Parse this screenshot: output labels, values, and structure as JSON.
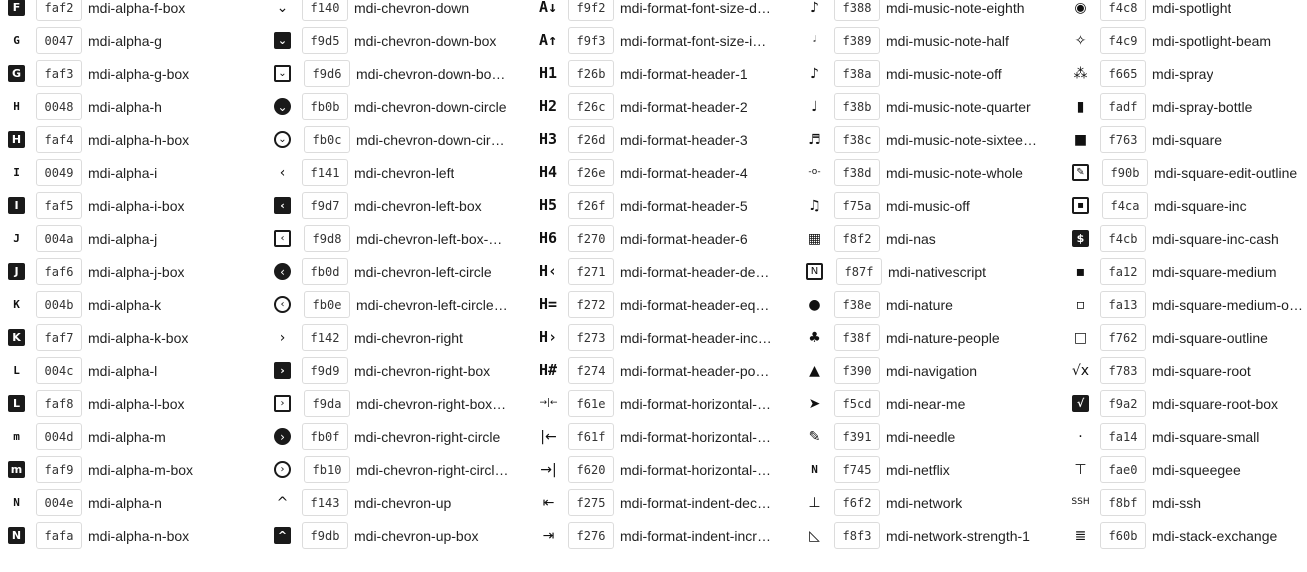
{
  "columns": [
    [
      {
        "code": "faf2",
        "name": "mdi-alpha-f-box",
        "glyph": "F",
        "style": "box",
        "icon": "alpha-f-box-icon"
      },
      {
        "code": "0047",
        "name": "mdi-alpha-g",
        "glyph": "G",
        "style": "letter",
        "icon": "alpha-g-icon"
      },
      {
        "code": "faf3",
        "name": "mdi-alpha-g-box",
        "glyph": "G",
        "style": "box",
        "icon": "alpha-g-box-icon"
      },
      {
        "code": "0048",
        "name": "mdi-alpha-h",
        "glyph": "H",
        "style": "letter",
        "icon": "alpha-h-icon"
      },
      {
        "code": "faf4",
        "name": "mdi-alpha-h-box",
        "glyph": "H",
        "style": "box",
        "icon": "alpha-h-box-icon"
      },
      {
        "code": "0049",
        "name": "mdi-alpha-i",
        "glyph": "I",
        "style": "letter",
        "icon": "alpha-i-icon"
      },
      {
        "code": "faf5",
        "name": "mdi-alpha-i-box",
        "glyph": "I",
        "style": "box",
        "icon": "alpha-i-box-icon"
      },
      {
        "code": "004a",
        "name": "mdi-alpha-j",
        "glyph": "J",
        "style": "letter",
        "icon": "alpha-j-icon"
      },
      {
        "code": "faf6",
        "name": "mdi-alpha-j-box",
        "glyph": "J",
        "style": "box",
        "icon": "alpha-j-box-icon"
      },
      {
        "code": "004b",
        "name": "mdi-alpha-k",
        "glyph": "K",
        "style": "letter",
        "icon": "alpha-k-icon"
      },
      {
        "code": "faf7",
        "name": "mdi-alpha-k-box",
        "glyph": "K",
        "style": "box",
        "icon": "alpha-k-box-icon"
      },
      {
        "code": "004c",
        "name": "mdi-alpha-l",
        "glyph": "L",
        "style": "letter",
        "icon": "alpha-l-icon"
      },
      {
        "code": "faf8",
        "name": "mdi-alpha-l-box",
        "glyph": "L",
        "style": "box",
        "icon": "alpha-l-box-icon"
      },
      {
        "code": "004d",
        "name": "mdi-alpha-m",
        "glyph": "m",
        "style": "letter",
        "icon": "alpha-m-icon"
      },
      {
        "code": "faf9",
        "name": "mdi-alpha-m-box",
        "glyph": "m",
        "style": "box",
        "icon": "alpha-m-box-icon"
      },
      {
        "code": "004e",
        "name": "mdi-alpha-n",
        "glyph": "N",
        "style": "letter",
        "icon": "alpha-n-icon"
      },
      {
        "code": "fafa",
        "name": "mdi-alpha-n-box",
        "glyph": "N",
        "style": "box",
        "icon": "alpha-n-box-icon"
      }
    ],
    [
      {
        "code": "f140",
        "name": "mdi-chevron-down",
        "glyph": "⌄",
        "style": "plain",
        "icon": "chevron-down-icon"
      },
      {
        "code": "f9d5",
        "name": "mdi-chevron-down-box",
        "glyph": "⌄",
        "style": "box",
        "icon": "chevron-down-box-icon"
      },
      {
        "code": "f9d6",
        "name": "mdi-chevron-down-box-outline",
        "glyph": "⌄",
        "style": "box-line",
        "icon": "chevron-down-box-outline-icon"
      },
      {
        "code": "fb0b",
        "name": "mdi-chevron-down-circle",
        "glyph": "⌄",
        "style": "circle-fill",
        "icon": "chevron-down-circle-icon"
      },
      {
        "code": "fb0c",
        "name": "mdi-chevron-down-circle-outline",
        "glyph": "⌄",
        "style": "circle-line",
        "icon": "chevron-down-circle-outline-icon"
      },
      {
        "code": "f141",
        "name": "mdi-chevron-left",
        "glyph": "‹",
        "style": "plain",
        "icon": "chevron-left-icon"
      },
      {
        "code": "f9d7",
        "name": "mdi-chevron-left-box",
        "glyph": "‹",
        "style": "box",
        "icon": "chevron-left-box-icon"
      },
      {
        "code": "f9d8",
        "name": "mdi-chevron-left-box-outline",
        "glyph": "‹",
        "style": "box-line",
        "icon": "chevron-left-box-outline-icon"
      },
      {
        "code": "fb0d",
        "name": "mdi-chevron-left-circle",
        "glyph": "‹",
        "style": "circle-fill",
        "icon": "chevron-left-circle-icon"
      },
      {
        "code": "fb0e",
        "name": "mdi-chevron-left-circle-outline",
        "glyph": "‹",
        "style": "circle-line",
        "icon": "chevron-left-circle-outline-icon"
      },
      {
        "code": "f142",
        "name": "mdi-chevron-right",
        "glyph": "›",
        "style": "plain",
        "icon": "chevron-right-icon"
      },
      {
        "code": "f9d9",
        "name": "mdi-chevron-right-box",
        "glyph": "›",
        "style": "box",
        "icon": "chevron-right-box-icon"
      },
      {
        "code": "f9da",
        "name": "mdi-chevron-right-box-outline",
        "glyph": "›",
        "style": "box-line",
        "icon": "chevron-right-box-outline-icon"
      },
      {
        "code": "fb0f",
        "name": "mdi-chevron-right-circle",
        "glyph": "›",
        "style": "circle-fill",
        "icon": "chevron-right-circle-icon"
      },
      {
        "code": "fb10",
        "name": "mdi-chevron-right-circle-outline",
        "glyph": "›",
        "style": "circle-line",
        "icon": "chevron-right-circle-outline-icon"
      },
      {
        "code": "f143",
        "name": "mdi-chevron-up",
        "glyph": "^",
        "style": "plain",
        "icon": "chevron-up-icon"
      },
      {
        "code": "f9db",
        "name": "mdi-chevron-up-box",
        "glyph": "^",
        "style": "box",
        "icon": "chevron-up-box-icon"
      }
    ],
    [
      {
        "code": "f9f2",
        "name": "mdi-format-font-size-decrease",
        "glyph": "A↓",
        "style": "header",
        "icon": "format-font-size-decrease-icon"
      },
      {
        "code": "f9f3",
        "name": "mdi-format-font-size-increase",
        "glyph": "A↑",
        "style": "header",
        "icon": "format-font-size-increase-icon"
      },
      {
        "code": "f26b",
        "name": "mdi-format-header-1",
        "glyph": "H1",
        "style": "header",
        "icon": "format-header-1-icon"
      },
      {
        "code": "f26c",
        "name": "mdi-format-header-2",
        "glyph": "H2",
        "style": "header",
        "icon": "format-header-2-icon"
      },
      {
        "code": "f26d",
        "name": "mdi-format-header-3",
        "glyph": "H3",
        "style": "header",
        "icon": "format-header-3-icon"
      },
      {
        "code": "f26e",
        "name": "mdi-format-header-4",
        "glyph": "H4",
        "style": "header",
        "icon": "format-header-4-icon"
      },
      {
        "code": "f26f",
        "name": "mdi-format-header-5",
        "glyph": "H5",
        "style": "header",
        "icon": "format-header-5-icon"
      },
      {
        "code": "f270",
        "name": "mdi-format-header-6",
        "glyph": "H6",
        "style": "header",
        "icon": "format-header-6-icon"
      },
      {
        "code": "f271",
        "name": "mdi-format-header-decrease",
        "glyph": "H‹",
        "style": "header",
        "icon": "format-header-decrease-icon"
      },
      {
        "code": "f272",
        "name": "mdi-format-header-equal",
        "glyph": "H=",
        "style": "header",
        "icon": "format-header-equal-icon"
      },
      {
        "code": "f273",
        "name": "mdi-format-header-increase",
        "glyph": "H›",
        "style": "header",
        "icon": "format-header-increase-icon"
      },
      {
        "code": "f274",
        "name": "mdi-format-header-pound",
        "glyph": "H#",
        "style": "header",
        "icon": "format-header-pound-icon"
      },
      {
        "code": "f61e",
        "name": "mdi-format-horizontal-align-center",
        "glyph": "→|←",
        "style": "plain",
        "icon": "format-horizontal-align-center-icon"
      },
      {
        "code": "f61f",
        "name": "mdi-format-horizontal-align-left",
        "glyph": "|←",
        "style": "plain",
        "icon": "format-horizontal-align-left-icon"
      },
      {
        "code": "f620",
        "name": "mdi-format-horizontal-align-right",
        "glyph": "→|",
        "style": "plain",
        "icon": "format-horizontal-align-right-icon"
      },
      {
        "code": "f275",
        "name": "mdi-format-indent-decrease",
        "glyph": "⇤",
        "style": "plain",
        "icon": "format-indent-decrease-icon"
      },
      {
        "code": "f276",
        "name": "mdi-format-indent-increase",
        "glyph": "⇥",
        "style": "plain",
        "icon": "format-indent-increase-icon"
      }
    ],
    [
      {
        "code": "f388",
        "name": "mdi-music-note-eighth",
        "glyph": "♪",
        "style": "plain",
        "icon": "music-note-eighth-icon"
      },
      {
        "code": "f389",
        "name": "mdi-music-note-half",
        "glyph": "𝅗𝅥",
        "style": "plain",
        "icon": "music-note-half-icon"
      },
      {
        "code": "f38a",
        "name": "mdi-music-note-off",
        "glyph": "♪",
        "style": "plain",
        "icon": "music-note-off-icon"
      },
      {
        "code": "f38b",
        "name": "mdi-music-note-quarter",
        "glyph": "♩",
        "style": "plain",
        "icon": "music-note-quarter-icon"
      },
      {
        "code": "f38c",
        "name": "mdi-music-note-sixteenth",
        "glyph": "♬",
        "style": "plain",
        "icon": "music-note-sixteenth-icon"
      },
      {
        "code": "f38d",
        "name": "mdi-music-note-whole",
        "glyph": "-o-",
        "style": "plain",
        "icon": "music-note-whole-icon"
      },
      {
        "code": "f75a",
        "name": "mdi-music-off",
        "glyph": "♫",
        "style": "plain",
        "icon": "music-off-icon"
      },
      {
        "code": "f8f2",
        "name": "mdi-nas",
        "glyph": "▦",
        "style": "plain",
        "icon": "nas-icon"
      },
      {
        "code": "f87f",
        "name": "mdi-nativescript",
        "glyph": "N",
        "style": "box-line",
        "icon": "nativescript-icon"
      },
      {
        "code": "f38e",
        "name": "mdi-nature",
        "glyph": "●",
        "style": "plain",
        "icon": "nature-icon"
      },
      {
        "code": "f38f",
        "name": "mdi-nature-people",
        "glyph": "♣",
        "style": "plain",
        "icon": "nature-people-icon"
      },
      {
        "code": "f390",
        "name": "mdi-navigation",
        "glyph": "▲",
        "style": "plain",
        "icon": "navigation-icon"
      },
      {
        "code": "f5cd",
        "name": "mdi-near-me",
        "glyph": "➤",
        "style": "plain",
        "icon": "near-me-icon"
      },
      {
        "code": "f391",
        "name": "mdi-needle",
        "glyph": "✎",
        "style": "plain",
        "icon": "needle-icon"
      },
      {
        "code": "f745",
        "name": "mdi-netflix",
        "glyph": "N",
        "style": "letter",
        "icon": "netflix-icon"
      },
      {
        "code": "f6f2",
        "name": "mdi-network",
        "glyph": "⊥",
        "style": "plain",
        "icon": "network-icon"
      },
      {
        "code": "f8f3",
        "name": "mdi-network-strength-1",
        "glyph": "◺",
        "style": "plain",
        "icon": "network-strength-1-icon"
      }
    ],
    [
      {
        "code": "f4c8",
        "name": "mdi-spotlight",
        "glyph": "◉",
        "style": "plain",
        "icon": "spotlight-icon"
      },
      {
        "code": "f4c9",
        "name": "mdi-spotlight-beam",
        "glyph": "✧",
        "style": "plain",
        "icon": "spotlight-beam-icon"
      },
      {
        "code": "f665",
        "name": "mdi-spray",
        "glyph": "⁂",
        "style": "plain",
        "icon": "spray-icon"
      },
      {
        "code": "fadf",
        "name": "mdi-spray-bottle",
        "glyph": "▮",
        "style": "plain",
        "icon": "spray-bottle-icon"
      },
      {
        "code": "f763",
        "name": "mdi-square",
        "glyph": "■",
        "style": "plain",
        "icon": "square-icon"
      },
      {
        "code": "f90b",
        "name": "mdi-square-edit-outline",
        "glyph": "✎",
        "style": "box-line",
        "icon": "square-edit-outline-icon"
      },
      {
        "code": "f4ca",
        "name": "mdi-square-inc",
        "glyph": "▪",
        "style": "box-line",
        "icon": "square-inc-icon"
      },
      {
        "code": "f4cb",
        "name": "mdi-square-inc-cash",
        "glyph": "$",
        "style": "box",
        "icon": "square-inc-cash-icon"
      },
      {
        "code": "fa12",
        "name": "mdi-square-medium",
        "glyph": "▪",
        "style": "plain",
        "icon": "square-medium-icon"
      },
      {
        "code": "fa13",
        "name": "mdi-square-medium-outline",
        "glyph": "▫",
        "style": "plain",
        "icon": "square-medium-outline-icon"
      },
      {
        "code": "f762",
        "name": "mdi-square-outline",
        "glyph": "□",
        "style": "plain",
        "icon": "square-outline-icon"
      },
      {
        "code": "f783",
        "name": "mdi-square-root",
        "glyph": "√x",
        "style": "plain",
        "icon": "square-root-icon"
      },
      {
        "code": "f9a2",
        "name": "mdi-square-root-box",
        "glyph": "√",
        "style": "box",
        "icon": "square-root-box-icon"
      },
      {
        "code": "fa14",
        "name": "mdi-square-small",
        "glyph": "·",
        "style": "plain",
        "icon": "square-small-icon"
      },
      {
        "code": "fae0",
        "name": "mdi-squeegee",
        "glyph": "⊤",
        "style": "plain",
        "icon": "squeegee-icon"
      },
      {
        "code": "f8bf",
        "name": "mdi-ssh",
        "glyph": "SSH",
        "style": "plain",
        "icon": "ssh-icon"
      },
      {
        "code": "f60b",
        "name": "mdi-stack-exchange",
        "glyph": "≣",
        "style": "plain",
        "icon": "stack-exchange-icon"
      }
    ]
  ]
}
